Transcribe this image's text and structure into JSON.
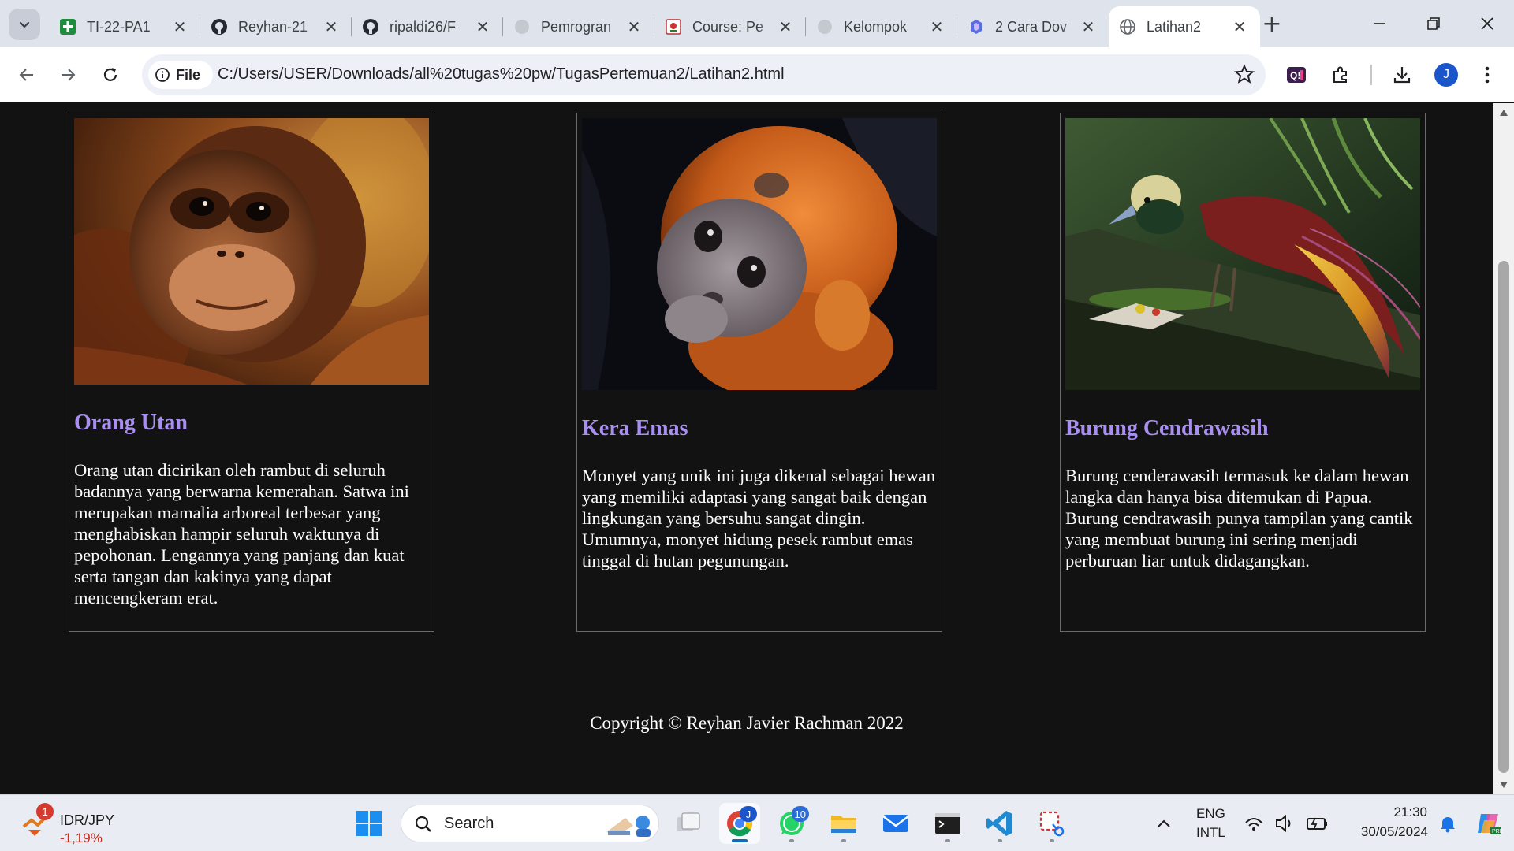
{
  "browser": {
    "tabs": [
      {
        "title": "TI-22-PA1",
        "favicon": "sheets-icon"
      },
      {
        "title": "Reyhan-21",
        "favicon": "github-icon"
      },
      {
        "title": "ripaldi26/F",
        "favicon": "github-icon"
      },
      {
        "title": "Pemrogran",
        "favicon": "globe-icon"
      },
      {
        "title": "Course: Pe",
        "favicon": "course-icon"
      },
      {
        "title": "Kelompok",
        "favicon": "globe-icon"
      },
      {
        "title": "2 Cara Dov",
        "favicon": "site-icon"
      },
      {
        "title": "Latihan2",
        "favicon": "globe-icon",
        "active": true
      }
    ],
    "address": {
      "chip_label": "File",
      "url": "C:/Users/USER/Downloads/all%20tugas%20pw/TugasPertemuan2/Latihan2.html"
    },
    "profile_initial": "J"
  },
  "page": {
    "cards": [
      {
        "title": "Orang Utan",
        "image": "orangutan-photo",
        "description": "Orang utan dicirikan oleh rambut di seluruh badannya yang berwarna kemerahan. Satwa ini merupakan mamalia arboreal terbesar yang menghabiskan hampir seluruh waktunya di pepohonan. Lengannya yang panjang dan kuat serta tangan dan kakinya yang dapat mencengkeram erat."
      },
      {
        "title": "Kera Emas",
        "image": "golden-monkey-photo",
        "description": "Monyet yang unik ini juga dikenal sebagai hewan yang memiliki adaptasi yang sangat baik dengan lingkungan yang bersuhu sangat dingin. Umumnya, monyet hidung pesek rambut emas tinggal di hutan pegunungan."
      },
      {
        "title": "Burung Cendrawasih",
        "image": "bird-of-paradise-photo",
        "description": "Burung cenderawasih termasuk ke dalam hewan langka dan hanya bisa ditemukan di Papua. Burung cendrawasih punya tampilan yang cantik yang membuat burung ini sering menjadi perburuan liar untuk didagangkan."
      }
    ],
    "footer": "Copyright © Reyhan Javier Rachman 2022",
    "colors": {
      "background": "#121212",
      "heading": "#a98ff2",
      "text": "#ffffff"
    }
  },
  "taskbar": {
    "widget": {
      "badge": "1",
      "pair": "IDR/JPY",
      "change": "-1,19%"
    },
    "search_label": "Search",
    "whatsapp_badge": "10",
    "tray": {
      "lang_top": "ENG",
      "lang_bottom": "INTL",
      "time": "21:30",
      "date": "30/05/2024"
    }
  }
}
